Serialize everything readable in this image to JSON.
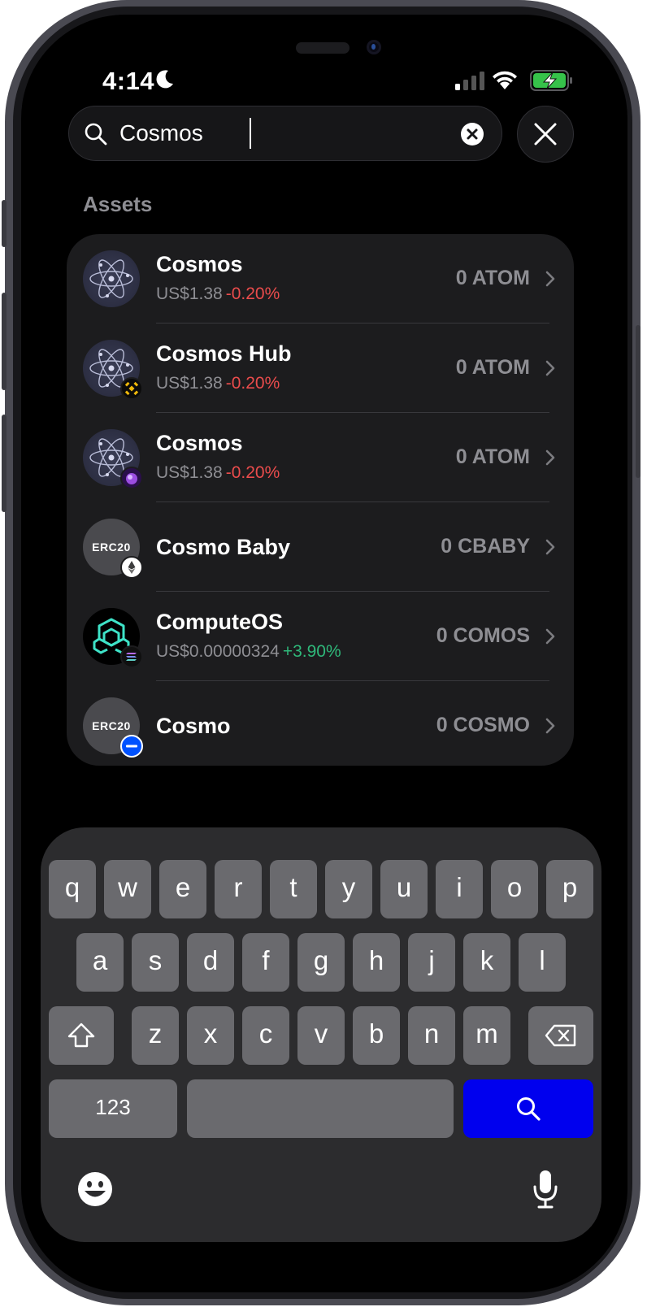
{
  "status_bar": {
    "time": "4:14",
    "icons": [
      "moon-icon",
      "cellular-signal-icon",
      "wifi-icon",
      "battery-charging-icon"
    ]
  },
  "search": {
    "value": "Cosmos",
    "clear_icon": "clear-icon",
    "close_icon": "close-icon"
  },
  "assets": {
    "section_title": "Assets",
    "items": [
      {
        "name": "Cosmos",
        "price": "US$1.38",
        "change": "-0.20%",
        "amount": "0 ATOM",
        "icon": "cosmos-atom-icon",
        "badge": ""
      },
      {
        "name": "Cosmos Hub",
        "price": "US$1.38",
        "change": "-0.20%",
        "amount": "0 ATOM",
        "icon": "cosmos-atom-icon",
        "badge": "bnb-chain-badge-icon"
      },
      {
        "name": "Cosmos",
        "price": "US$1.38",
        "change": "-0.20%",
        "amount": "0 ATOM",
        "icon": "cosmos-atom-icon",
        "badge": "osmosis-badge-icon"
      },
      {
        "name": "Cosmo Baby",
        "icon_text": "ERC20",
        "amount": "0 CBABY",
        "icon": "erc20-token-icon",
        "badge": "ethereum-badge-icon"
      },
      {
        "name": "ComputeOS",
        "price": "US$0.00000324",
        "change": "+3.90%",
        "amount": "0 COMOS",
        "icon": "computeos-logo-icon",
        "badge": "solana-badge-icon"
      },
      {
        "name": "Cosmo",
        "icon_text": "ERC20",
        "amount": "0 COSMO",
        "icon": "erc20-token-icon",
        "badge": "base-badge-icon"
      }
    ]
  },
  "keyboard": {
    "row1": [
      "q",
      "w",
      "e",
      "r",
      "t",
      "y",
      "u",
      "i",
      "o",
      "p"
    ],
    "row2": [
      "a",
      "s",
      "d",
      "f",
      "g",
      "h",
      "j",
      "k",
      "l"
    ],
    "row3": [
      "z",
      "x",
      "c",
      "v",
      "b",
      "n",
      "m"
    ],
    "numbers_label": "123",
    "icons": [
      "shift-icon",
      "delete-icon",
      "search-key-icon",
      "emoji-icon",
      "microphone-icon"
    ],
    "search_key_color": "#0000ee"
  },
  "colors": {
    "negative": "#ea4c4c",
    "positive": "#2fb87a",
    "card": "#1c1c1e"
  }
}
